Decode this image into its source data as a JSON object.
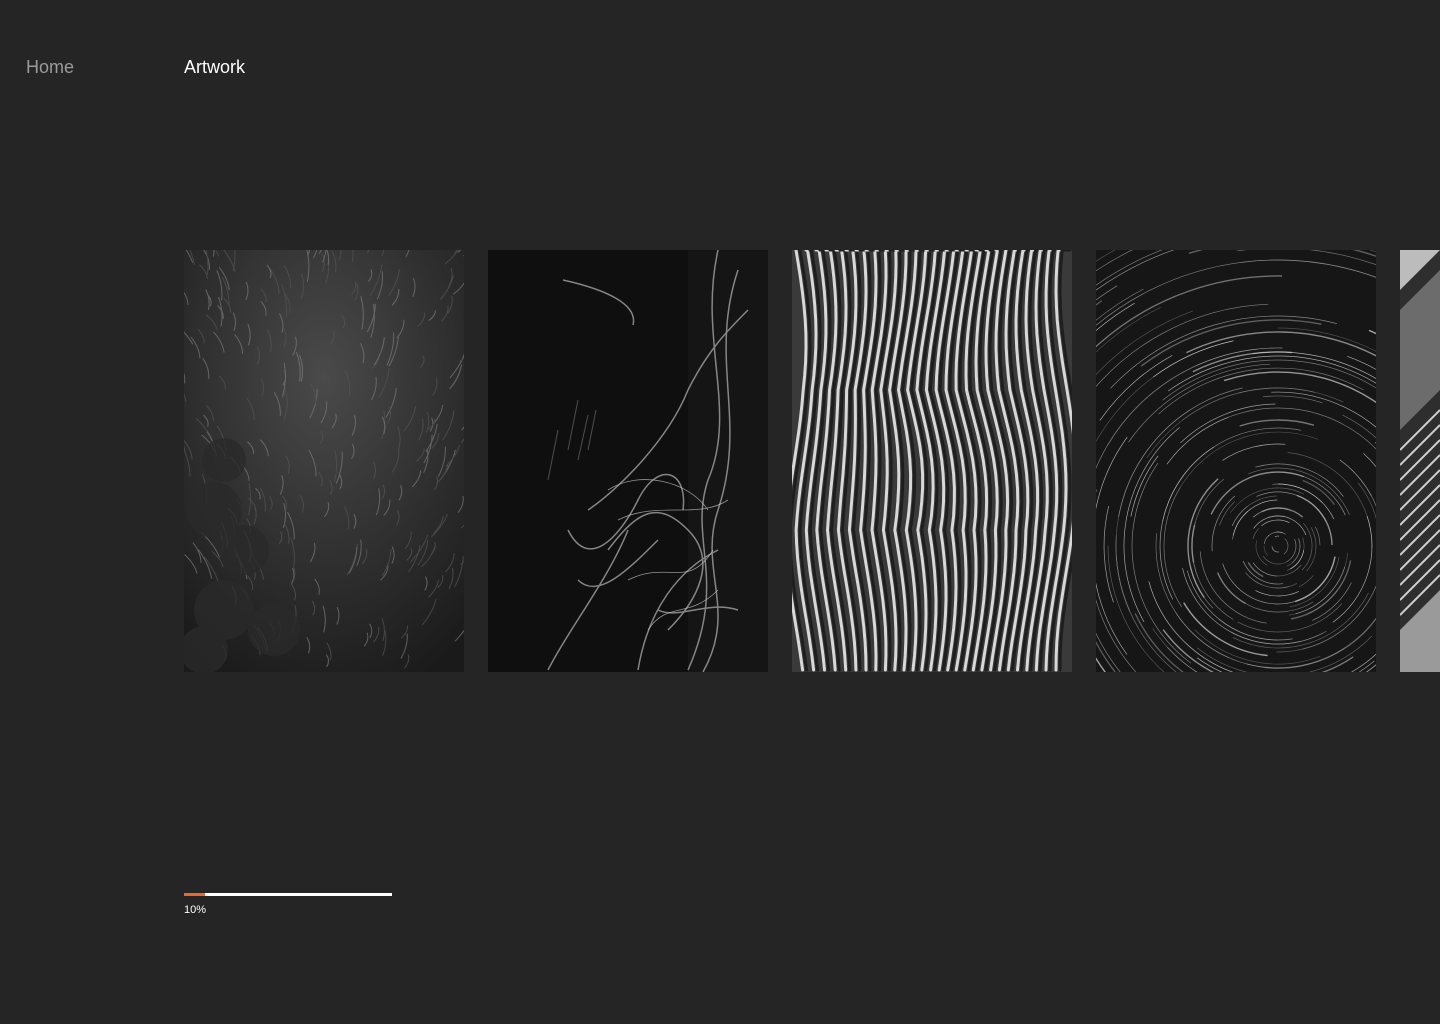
{
  "nav": {
    "home_label": "Home",
    "title": "Artwork"
  },
  "gallery": {
    "items": [
      {
        "name": "artwork-feather-texture"
      },
      {
        "name": "artwork-light-trails"
      },
      {
        "name": "artwork-wave-ridges"
      },
      {
        "name": "artwork-star-trails"
      },
      {
        "name": "artwork-architecture-partial"
      }
    ]
  },
  "progress": {
    "value": 0.1,
    "label": "10%",
    "fill_color": "#e8692c",
    "track_color": "#ffffff"
  },
  "colors": {
    "background": "#252525",
    "nav_inactive": "#9a9a9a",
    "nav_active": "#ffffff"
  }
}
